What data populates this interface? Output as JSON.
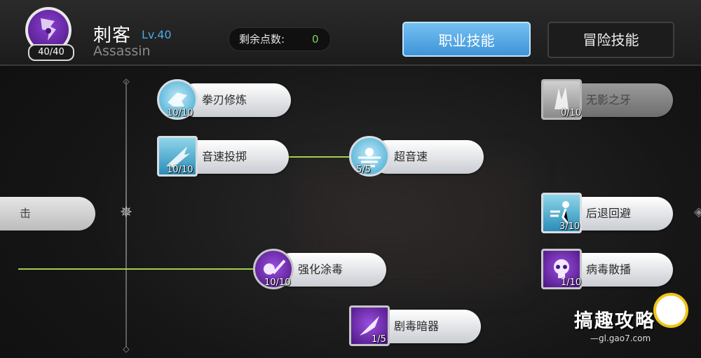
{
  "header": {
    "class_name": "刺客",
    "class_level": "Lv.40",
    "class_name_en": "Assassin",
    "avatar_level": "40/40",
    "points_label": "剩余点数:",
    "points_value": "0",
    "tabs": [
      {
        "label": "职业技能",
        "active": true
      },
      {
        "label": "冒险技能",
        "active": false
      }
    ]
  },
  "skills": [
    {
      "name": "拳刃修炼",
      "count": "10/10",
      "icon": "fist-blade-icon"
    },
    {
      "name": "音速投掷",
      "count": "10/10",
      "icon": "sonic-throw-icon"
    },
    {
      "name": "超音速",
      "count": "5/5",
      "icon": "supersonic-icon"
    },
    {
      "name": "强化涂毒",
      "count": "10/10",
      "icon": "poison-blade-icon"
    },
    {
      "name": "剧毒暗器",
      "count": "1/5",
      "icon": "poison-dart-icon"
    },
    {
      "name": "无影之牙",
      "count": "0/10",
      "icon": "shadow-fang-icon"
    },
    {
      "name": "后退回避",
      "count": "3/10",
      "icon": "backstep-icon"
    },
    {
      "name": "病毒散播",
      "count": "1/10",
      "icon": "virus-skull-icon"
    }
  ],
  "left_partial_skill": "击",
  "watermark": {
    "text": "搞趣攻略",
    "url": "—gl.gao7.com"
  },
  "colors": {
    "accent": "#4aa9e6",
    "points": "#7fd35c",
    "connector": "#9fd04a",
    "tab_active": "#3f94d8"
  }
}
